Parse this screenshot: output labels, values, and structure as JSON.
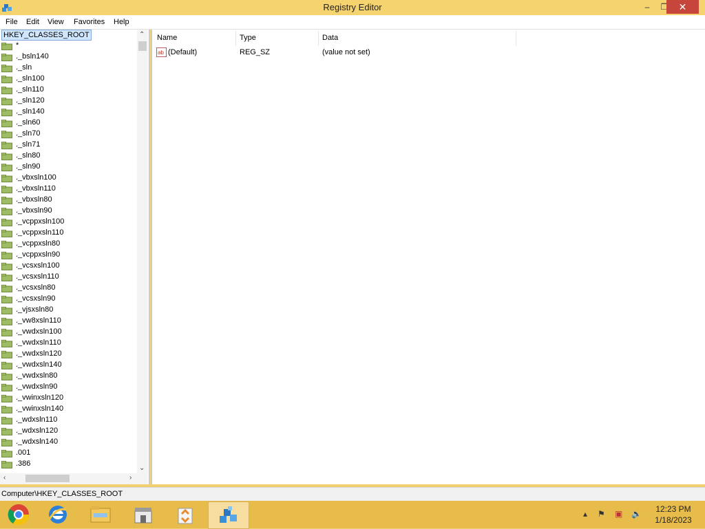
{
  "window": {
    "title": "Registry Editor",
    "controls": {
      "minimize": "–",
      "maximize": "❐",
      "close": "✕"
    }
  },
  "menu": [
    "File",
    "Edit",
    "View",
    "Favorites",
    "Help"
  ],
  "tree": {
    "root": "HKEY_CLASSES_ROOT",
    "items": [
      "*",
      "._bsln140",
      "._sln",
      "._sln100",
      "._sln110",
      "._sln120",
      "._sln140",
      "._sln60",
      "._sln70",
      "._sln71",
      "._sln80",
      "._sln90",
      "._vbxsln100",
      "._vbxsln110",
      "._vbxsln80",
      "._vbxsln90",
      "._vcppxsln100",
      "._vcppxsln110",
      "._vcppxsln80",
      "._vcppxsln90",
      "._vcsxsln100",
      "._vcsxsln110",
      "._vcsxsln80",
      "._vcsxsln90",
      "._vjsxsln80",
      "._vw8xsln110",
      "._vwdxsln100",
      "._vwdxsln110",
      "._vwdxsln120",
      "._vwdxsln140",
      "._vwdxsln80",
      "._vwdxsln90",
      "._vwinxsln120",
      "._vwinxsln140",
      "._wdxsln110",
      "._wdxsln120",
      "._wdxsln140",
      ".001",
      ".386"
    ]
  },
  "list": {
    "columns": [
      "Name",
      "Type",
      "Data"
    ],
    "rows": [
      {
        "name": "(Default)",
        "type": "REG_SZ",
        "data": "(value not set)",
        "icon": "string-value-icon"
      }
    ]
  },
  "status": "Computer\\HKEY_CLASSES_ROOT",
  "taskbar": {
    "apps": [
      "chrome-icon",
      "ie-icon",
      "file-explorer-icon",
      "store-icon",
      "recycle-icon",
      "regedit-icon"
    ],
    "active": 5,
    "clock": {
      "time": "12:23 PM",
      "date": "1/18/2023"
    }
  },
  "colors": {
    "titlebar": "#f5d36f",
    "taskbar": "#e8bc4a",
    "close": "#c7463c",
    "selection": "#cfe6fc"
  }
}
